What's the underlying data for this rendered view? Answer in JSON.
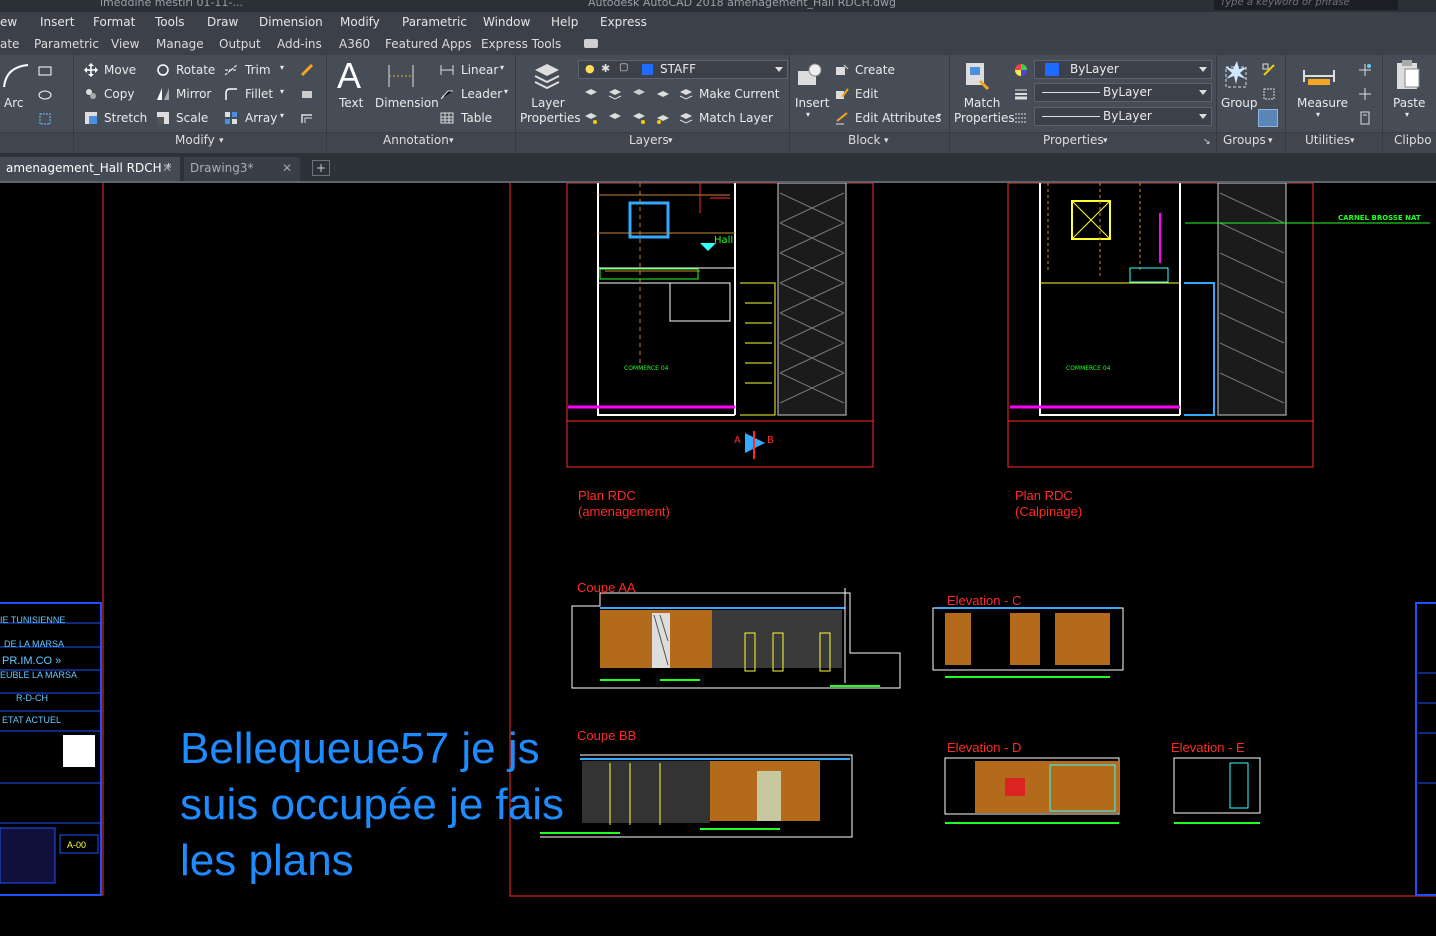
{
  "titlebar": {
    "left_text": "imeddine mestiri 01-11-...",
    "center_text": "Autodesk AutoCAD 2018   amenagement_Hall RDCH.dwg",
    "search_placeholder": "Type a keyword or phrase"
  },
  "menu": [
    "ew",
    "Insert",
    "Format",
    "Tools",
    "Draw",
    "Dimension",
    "Modify",
    "Parametric",
    "Window",
    "Help",
    "Express"
  ],
  "ribbon_tabs": [
    "ate",
    "Parametric",
    "View",
    "Manage",
    "Output",
    "Add-ins",
    "A360",
    "Featured Apps",
    "Express Tools"
  ],
  "draw_panel": {
    "arc": "Arc"
  },
  "modify_panel": {
    "label": "Modify",
    "move": "Move",
    "rotate": "Rotate",
    "trim": "Trim",
    "copy": "Copy",
    "mirror": "Mirror",
    "fillet": "Fillet",
    "stretch": "Stretch",
    "scale": "Scale",
    "array": "Array"
  },
  "annotation_panel": {
    "label": "Annotation",
    "text": "Text",
    "dimension": "Dimension",
    "linear": "Linear",
    "leader": "Leader",
    "table": "Table"
  },
  "layers_panel": {
    "label": "Layers",
    "layer_properties": "Layer Properties",
    "current_layer": "STAFF",
    "make_current": "Make Current",
    "match_layer": "Match Layer"
  },
  "block_panel": {
    "label": "Block",
    "insert": "Insert",
    "create": "Create",
    "edit": "Edit",
    "edit_attributes": "Edit Attributes"
  },
  "properties_panel": {
    "label": "Properties",
    "match_properties": "Match Properties",
    "color": "ByLayer",
    "linetype": "ByLayer",
    "lineweight": "ByLayer"
  },
  "groups_panel": {
    "label": "Groups",
    "group": "Group"
  },
  "utilities_panel": {
    "label": "Utilities",
    "measure": "Measure"
  },
  "clipboard_panel": {
    "label": "Clipbo",
    "paste": "Paste"
  },
  "doc_tabs": [
    {
      "label": "amenagement_Hall RDCH *",
      "close": "✕"
    },
    {
      "label": "Drawing3*",
      "close": "✕"
    }
  ],
  "new_tab": "+",
  "drawing": {
    "overlay_lines": [
      "Bellequeue57 je js",
      "suis occupée je fais",
      "les plans"
    ],
    "plan1_title": "Plan  RDC",
    "plan1_sub": "(amenagement)",
    "plan2_title": "Plan  RDC",
    "plan2_sub": "(Calpinage)",
    "coupe_aa": "Coupe AA",
    "coupe_bb": "Coupe BB",
    "elev_c": "Elevation - C",
    "elev_d": "Elevation - D",
    "elev_e": "Elevation - E",
    "commerce": "COMMERCE 04",
    "hall": "Hall",
    "section_a": "A",
    "section_b": "B",
    "callout": "CARNEL BROSSE NAT",
    "titleblock": [
      "IE TUNISIENNE",
      "DE LA MARSA",
      "PR.IM.CO »",
      "EUBLE LA MARSA",
      "R-D-CH",
      "ETAT ACTUEL",
      "A-00"
    ]
  },
  "colors": {
    "accent_blue": "#1e8cff",
    "cad_red": "#ff2a2a",
    "cad_green": "#22ff22",
    "cad_yellow": "#ffff33"
  }
}
